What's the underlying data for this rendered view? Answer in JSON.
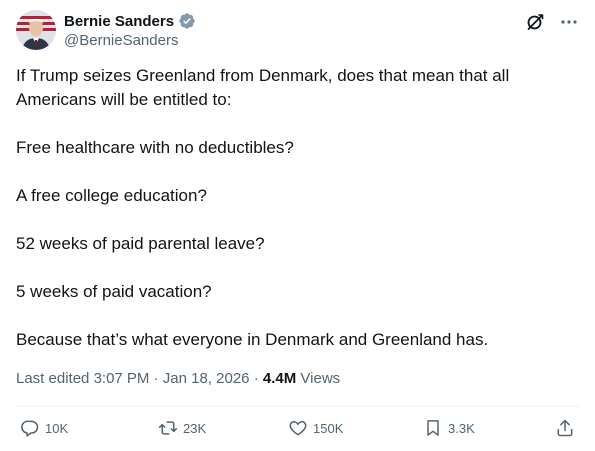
{
  "author": {
    "display_name": "Bernie Sanders",
    "handle": "@BernieSanders",
    "verified_color": "#829aab"
  },
  "tweet": {
    "paragraphs": [
      "If Trump seizes Greenland from Denmark, does that mean that all Americans will be entitled to:",
      "Free healthcare with no deductibles?",
      "A free college education?",
      "52 weeks of paid parental leave?",
      "5 weeks of paid vacation?",
      "Because that’s what everyone in Denmark and Greenland has."
    ]
  },
  "meta": {
    "edited_label": "Last edited",
    "time": "3:07 PM",
    "date": "Jan 18, 2026",
    "views_count": "4.4M",
    "views_label": "Views"
  },
  "actions": {
    "replies": "10K",
    "reposts": "23K",
    "likes": "150K",
    "bookmarks": "3.3K"
  },
  "colors": {
    "text": "#0f1419",
    "secondary": "#536471",
    "divider": "#eff3f4"
  }
}
